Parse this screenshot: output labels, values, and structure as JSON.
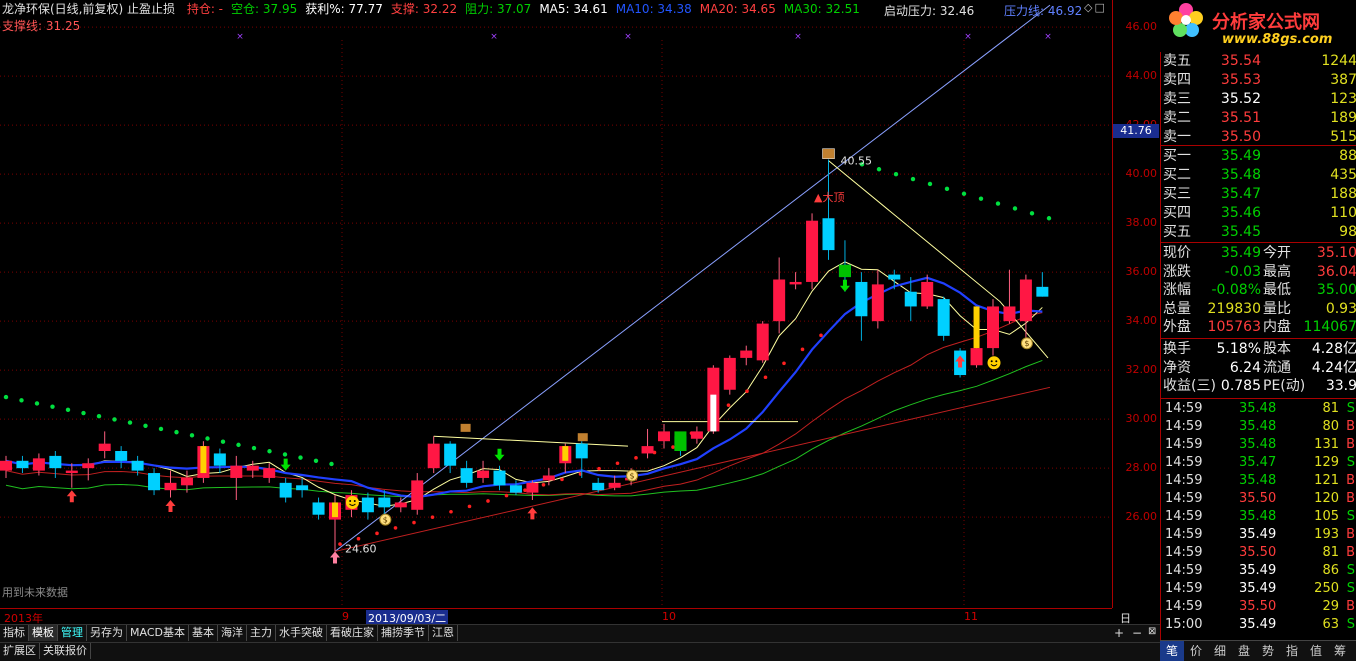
{
  "header": {
    "title": "龙净环保(日线,前复权) 止盈止损",
    "items": [
      {
        "label": "持仓: -",
        "color": "#ff4040"
      },
      {
        "label": "空仓: 37.95",
        "color": "#00d000"
      },
      {
        "label": "获利%: 77.77",
        "color": "#ffffff"
      },
      {
        "label": "支撑: 32.22",
        "color": "#ff4040"
      },
      {
        "label": "阻力: 37.07",
        "color": "#00d000"
      },
      {
        "label": "MA5: 34.61",
        "color": "#ffffff"
      },
      {
        "label": "MA10: 34.38",
        "color": "#2255ff"
      },
      {
        "label": "MA20: 34.65",
        "color": "#ff4040"
      },
      {
        "label": "MA30: 32.51",
        "color": "#00d000"
      }
    ],
    "line2": "支撑线: 31.25",
    "qidong": "启动压力: 32.46",
    "yali": "压力线: 46.92"
  },
  "watermark": "用到未来数据",
  "annotations": {
    "high_price": "40.55",
    "low_price": "24.60",
    "top_label": "大顶"
  },
  "date_axis": {
    "labels": [
      {
        "text": "2013年",
        "selected": false
      },
      {
        "text": "9",
        "selected": false
      },
      {
        "text": "2013/09/03/二",
        "selected": true
      },
      {
        "text": "10",
        "selected": false
      },
      {
        "text": "11",
        "selected": false
      }
    ],
    "period": "日线"
  },
  "y_axis": {
    "ticks": [
      "46.00",
      "44.00",
      "42.00",
      "40.00",
      "38.00",
      "36.00",
      "34.00",
      "32.00",
      "30.00",
      "28.00",
      "26.00"
    ],
    "marker": "41.76"
  },
  "tabs_row1": [
    "指标",
    "模板",
    "管理",
    "另存为",
    "MACD基本",
    "基本",
    "海洋",
    "主力",
    "水手突破",
    "看破庄家",
    "捕捞季节",
    "江恩"
  ],
  "tabs_row2": [
    "扩展区",
    "关联报价"
  ],
  "panel": {
    "logo_text": "分析家公式网",
    "logo_url": "www.88gs.com",
    "asks": [
      {
        "label": "卖五",
        "price": "35.54",
        "vol": "1244"
      },
      {
        "label": "卖四",
        "price": "35.53",
        "vol": "387"
      },
      {
        "label": "卖三",
        "price": "35.52",
        "vol": "123"
      },
      {
        "label": "卖二",
        "price": "35.51",
        "vol": "189"
      },
      {
        "label": "卖一",
        "price": "35.50",
        "vol": "515"
      }
    ],
    "bids": [
      {
        "label": "买一",
        "price": "35.49",
        "vol": "88"
      },
      {
        "label": "买二",
        "price": "35.48",
        "vol": "435"
      },
      {
        "label": "买三",
        "price": "35.47",
        "vol": "188"
      },
      {
        "label": "买四",
        "price": "35.46",
        "vol": "110"
      },
      {
        "label": "买五",
        "price": "35.45",
        "vol": "98"
      }
    ],
    "stats": [
      {
        "l": "现价",
        "v1": "35.49",
        "l2": "今开",
        "v2": "35.10"
      },
      {
        "l": "涨跌",
        "v1": "-0.03",
        "l2": "最高",
        "v2": "36.04"
      },
      {
        "l": "涨幅",
        "v1": "-0.08%",
        "l2": "最低",
        "v2": "35.00"
      },
      {
        "l": "总量",
        "v1": "219830",
        "l2": "量比",
        "v2": "0.93"
      },
      {
        "l": "外盘",
        "v1": "105763",
        "l2": "内盘",
        "v2": "114067"
      }
    ],
    "fundamentals": [
      {
        "l": "换手",
        "v1": "5.18%",
        "l2": "股本",
        "v2": "4.28亿"
      },
      {
        "l": "净资",
        "v1": "6.24",
        "l2": "流通",
        "v2": "4.24亿"
      },
      {
        "l": "收益(三)",
        "v1": "0.785",
        "l2": "PE(动)",
        "v2": "33.9"
      }
    ],
    "ticks": [
      {
        "t": "14:59",
        "p": "35.48",
        "v": "81",
        "s": "S"
      },
      {
        "t": "14:59",
        "p": "35.48",
        "v": "80",
        "s": "B"
      },
      {
        "t": "14:59",
        "p": "35.48",
        "v": "131",
        "s": "B"
      },
      {
        "t": "14:59",
        "p": "35.47",
        "v": "129",
        "s": "S"
      },
      {
        "t": "14:59",
        "p": "35.48",
        "v": "121",
        "s": "B"
      },
      {
        "t": "14:59",
        "p": "35.50",
        "v": "120",
        "s": "B"
      },
      {
        "t": "14:59",
        "p": "35.48",
        "v": "105",
        "s": "S"
      },
      {
        "t": "14:59",
        "p": "35.49",
        "v": "193",
        "s": "B"
      },
      {
        "t": "14:59",
        "p": "35.50",
        "v": "81",
        "s": "B"
      },
      {
        "t": "14:59",
        "p": "35.49",
        "v": "86",
        "s": "S"
      },
      {
        "t": "14:59",
        "p": "35.49",
        "v": "250",
        "s": "S"
      },
      {
        "t": "14:59",
        "p": "35.50",
        "v": "29",
        "s": "B"
      },
      {
        "t": "15:00",
        "p": "35.49",
        "v": "63",
        "s": "S"
      }
    ],
    "bottom_buttons": [
      "笔",
      "价",
      "细",
      "盘",
      "势",
      "指",
      "值",
      "筹"
    ]
  },
  "candles": [
    {
      "o": 27.9,
      "c": 28.3,
      "h": 28.5,
      "l": 27.6
    },
    {
      "o": 28.3,
      "c": 28.0,
      "h": 28.5,
      "l": 27.8
    },
    {
      "o": 27.9,
      "c": 28.4,
      "h": 28.6,
      "l": 27.7
    },
    {
      "o": 28.5,
      "c": 28.0,
      "h": 28.7,
      "l": 27.6
    },
    {
      "o": 27.8,
      "c": 27.9,
      "h": 28.2,
      "l": 27.2
    },
    {
      "o": 28.0,
      "c": 28.2,
      "h": 28.4,
      "l": 27.5
    },
    {
      "o": 28.7,
      "c": 29.0,
      "h": 29.5,
      "l": 28.4
    },
    {
      "o": 28.7,
      "c": 28.3,
      "h": 28.9,
      "l": 28.0
    },
    {
      "o": 28.3,
      "c": 27.9,
      "h": 28.5,
      "l": 27.7
    },
    {
      "o": 27.8,
      "c": 27.1,
      "h": 28.0,
      "l": 26.9
    },
    {
      "o": 27.1,
      "c": 27.4,
      "h": 27.9,
      "l": 26.8
    },
    {
      "o": 27.3,
      "c": 27.6,
      "h": 27.9,
      "l": 27.0
    },
    {
      "o": 27.6,
      "c": 28.9,
      "h": 29.1,
      "l": 27.4
    },
    {
      "o": 28.6,
      "c": 28.1,
      "h": 28.8,
      "l": 27.8
    },
    {
      "o": 27.6,
      "c": 28.1,
      "h": 28.5,
      "l": 26.7
    },
    {
      "o": 27.9,
      "c": 28.1,
      "h": 28.3,
      "l": 27.6
    },
    {
      "o": 27.6,
      "c": 28.0,
      "h": 28.2,
      "l": 27.4
    },
    {
      "o": 27.4,
      "c": 26.8,
      "h": 27.6,
      "l": 26.6
    },
    {
      "o": 27.3,
      "c": 27.1,
      "h": 27.6,
      "l": 26.8
    },
    {
      "o": 26.6,
      "c": 26.1,
      "h": 26.8,
      "l": 25.9
    },
    {
      "o": 25.9,
      "c": 26.6,
      "h": 26.9,
      "l": 24.6
    },
    {
      "o": 26.3,
      "c": 26.9,
      "h": 27.1,
      "l": 26.0
    },
    {
      "o": 26.8,
      "c": 26.2,
      "h": 27.0,
      "l": 25.9
    },
    {
      "o": 26.8,
      "c": 26.4,
      "h": 27.1,
      "l": 26.1
    },
    {
      "o": 26.4,
      "c": 26.6,
      "h": 26.8,
      "l": 26.2
    },
    {
      "o": 26.3,
      "c": 27.5,
      "h": 27.8,
      "l": 26.1
    },
    {
      "o": 28.0,
      "c": 29.0,
      "h": 29.3,
      "l": 27.8
    },
    {
      "o": 29.0,
      "c": 28.1,
      "h": 29.1,
      "l": 27.8
    },
    {
      "o": 28.0,
      "c": 27.4,
      "h": 28.3,
      "l": 27.2
    },
    {
      "o": 27.6,
      "c": 27.9,
      "h": 28.3,
      "l": 27.4
    },
    {
      "o": 27.9,
      "c": 27.3,
      "h": 28.1,
      "l": 27.1
    },
    {
      "o": 27.3,
      "c": 27.0,
      "h": 27.5,
      "l": 26.9
    },
    {
      "o": 27.0,
      "c": 27.4,
      "h": 27.5,
      "l": 26.7
    },
    {
      "o": 27.5,
      "c": 27.7,
      "h": 28.0,
      "l": 27.3
    },
    {
      "o": 28.2,
      "c": 28.9,
      "h": 29.0,
      "l": 27.8
    },
    {
      "o": 29.0,
      "c": 28.4,
      "h": 29.1,
      "l": 27.6
    },
    {
      "o": 27.4,
      "c": 27.1,
      "h": 27.6,
      "l": 27.0
    },
    {
      "o": 27.2,
      "c": 27.4,
      "h": 27.7,
      "l": 27.1
    },
    {
      "o": 27.5,
      "c": 27.6,
      "h": 28.0,
      "l": 27.3
    },
    {
      "o": 28.6,
      "c": 28.9,
      "h": 29.6,
      "l": 28.4
    },
    {
      "o": 29.1,
      "c": 29.5,
      "h": 29.8,
      "l": 28.8
    },
    {
      "o": 29.3,
      "c": 28.7,
      "h": 29.4,
      "l": 28.5
    },
    {
      "o": 29.2,
      "c": 29.5,
      "h": 29.7,
      "l": 29.0
    },
    {
      "o": 29.5,
      "c": 32.1,
      "h": 32.2,
      "l": 29.4
    },
    {
      "o": 31.2,
      "c": 32.5,
      "h": 32.6,
      "l": 31.0
    },
    {
      "o": 32.5,
      "c": 32.8,
      "h": 33.0,
      "l": 32.2
    },
    {
      "o": 32.4,
      "c": 33.9,
      "h": 34.0,
      "l": 32.3
    },
    {
      "o": 34.0,
      "c": 35.7,
      "h": 36.6,
      "l": 33.5
    },
    {
      "o": 35.5,
      "c": 35.6,
      "h": 36.0,
      "l": 35.3
    },
    {
      "o": 35.6,
      "c": 38.1,
      "h": 38.4,
      "l": 35.3
    },
    {
      "o": 38.2,
      "c": 36.9,
      "h": 40.6,
      "l": 36.5
    },
    {
      "o": 36.3,
      "c": 35.8,
      "h": 37.3,
      "l": 35.2
    },
    {
      "o": 35.6,
      "c": 34.2,
      "h": 36.0,
      "l": 33.2
    },
    {
      "o": 34.0,
      "c": 35.5,
      "h": 36.1,
      "l": 33.7
    },
    {
      "o": 35.9,
      "c": 35.7,
      "h": 36.1,
      "l": 35.3
    },
    {
      "o": 35.2,
      "c": 34.6,
      "h": 35.8,
      "l": 34.0
    },
    {
      "o": 34.6,
      "c": 35.6,
      "h": 35.9,
      "l": 34.5
    },
    {
      "o": 34.9,
      "c": 33.4,
      "h": 35.0,
      "l": 33.2
    },
    {
      "o": 32.8,
      "c": 31.8,
      "h": 32.9,
      "l": 31.7
    },
    {
      "o": 32.2,
      "c": 32.9,
      "h": 33.1,
      "l": 32.1
    },
    {
      "o": 32.9,
      "c": 34.6,
      "h": 34.9,
      "l": 32.6
    },
    {
      "o": 34.0,
      "c": 34.6,
      "h": 36.1,
      "l": 33.9
    },
    {
      "o": 34.0,
      "c": 35.7,
      "h": 35.9,
      "l": 33.3
    },
    {
      "o": 35.4,
      "c": 35.0,
      "h": 36.0,
      "l": 35.0
    }
  ],
  "colors": {
    "up": "#ff1744",
    "down": "#00d0ff",
    "ma5": "#ffffa0",
    "ma10": "#2040ff",
    "ma20": "#c02020",
    "ma30": "#20c020",
    "sar": "#00e040",
    "stop": "#ff2020",
    "trend": "#8aa0ff"
  }
}
